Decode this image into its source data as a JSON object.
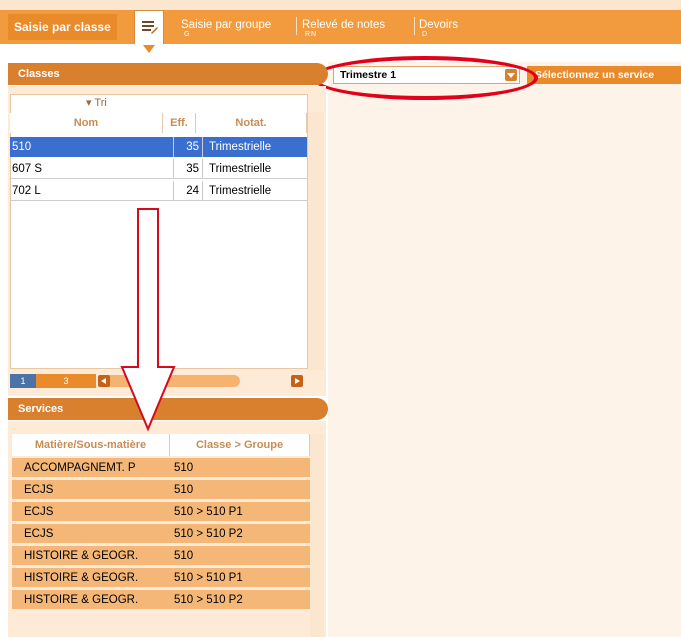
{
  "top_tabs": {
    "active": "Saisie par classe",
    "items": [
      {
        "label": "Saisie par groupe",
        "dots": "G"
      },
      {
        "label": "Relevé de notes",
        "dots": "RN"
      },
      {
        "label": "Devoirs",
        "dots": "D"
      }
    ]
  },
  "period_select": {
    "value": "Trimestre 1"
  },
  "service_hint": "Sélectionnez un service",
  "classes": {
    "title": "Classes",
    "sort_label": "Tri",
    "columns": [
      "Nom",
      "Eff.",
      "Notat."
    ],
    "rows": [
      {
        "name": "510",
        "eff": "35",
        "notation": "Trimestrielle",
        "selected": true
      },
      {
        "name": "607 S",
        "eff": "35",
        "notation": "Trimestrielle",
        "selected": false
      },
      {
        "name": "702 L",
        "eff": "24",
        "notation": "Trimestrielle",
        "selected": false
      }
    ],
    "pager": {
      "page": "1",
      "total": "3"
    }
  },
  "services": {
    "title": "Services",
    "columns": [
      "Matière/Sous-matière",
      "Classe > Groupe"
    ],
    "rows": [
      {
        "subject": "ACCOMPAGNEMT. P",
        "group": "510"
      },
      {
        "subject": "ECJS",
        "group": "510"
      },
      {
        "subject": "ECJS",
        "group": "510 > 510 P1"
      },
      {
        "subject": "ECJS",
        "group": "510 > 510 P2"
      },
      {
        "subject": "HISTOIRE & GEOGR.",
        "group": "510"
      },
      {
        "subject": "HISTOIRE & GEOGR.",
        "group": "510 > 510 P1"
      },
      {
        "subject": "HISTOIRE & GEOGR.",
        "group": "510 > 510 P2"
      }
    ]
  },
  "colors": {
    "accent": "#e98a2b",
    "selected_row": "#3a6fd0",
    "highlight_ring": "#e2001a"
  }
}
